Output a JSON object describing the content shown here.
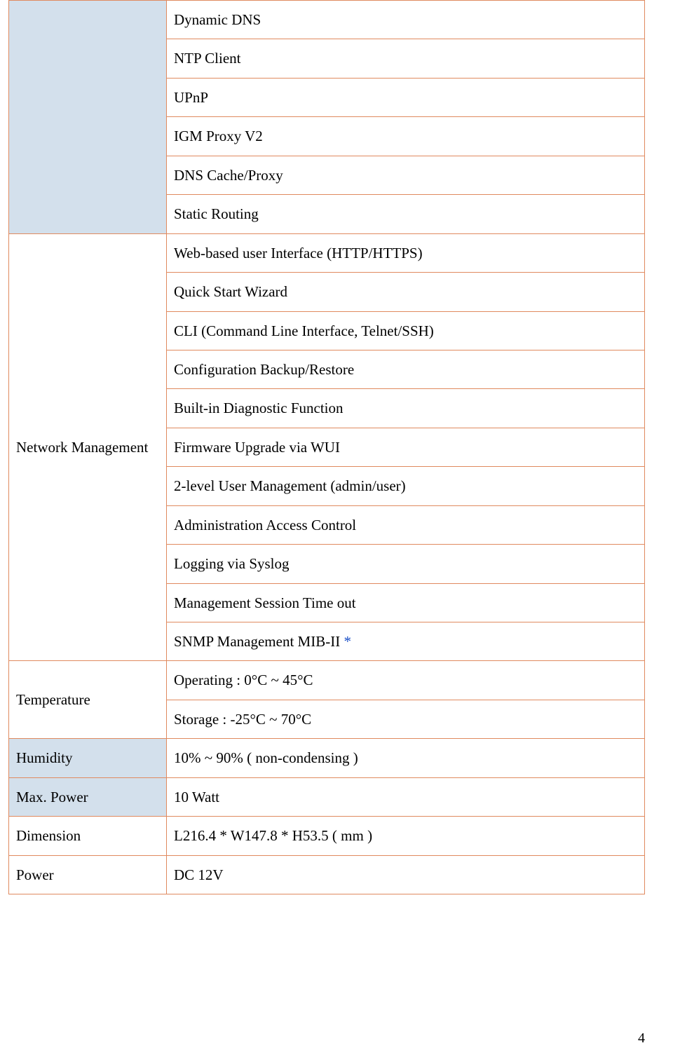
{
  "group0": {
    "items": [
      "Dynamic DNS",
      "NTP Client",
      "UPnP",
      "IGM Proxy V2",
      "DNS Cache/Proxy",
      "Static Routing"
    ]
  },
  "network_management": {
    "label": "Network Management",
    "items": [
      "Web-based user Interface (HTTP/HTTPS)",
      "Quick Start Wizard",
      "CLI (Command Line Interface, Telnet/SSH)",
      "Configuration Backup/Restore",
      "Built-in Diagnostic Function",
      "Firmware Upgrade via WUI",
      "2-level User Management (admin/user)",
      "Administration Access Control",
      "Logging via Syslog",
      "Management Session Time out",
      "SNMP Management MIB-II "
    ],
    "asterisk": "*"
  },
  "temperature": {
    "label": "Temperature",
    "items": [
      "Operating : 0°C ~ 45°C",
      "Storage : -25°C ~ 70°C"
    ]
  },
  "humidity": {
    "label": "Humidity",
    "value": "10% ~ 90% ( non-condensing )"
  },
  "max_power": {
    "label": "Max. Power",
    "value": "10 Watt"
  },
  "dimension": {
    "label": "Dimension",
    "value": "L216.4 * W147.8 * H53.5 ( mm )"
  },
  "power": {
    "label": "Power",
    "value": "DC 12V"
  },
  "page_number": "4"
}
